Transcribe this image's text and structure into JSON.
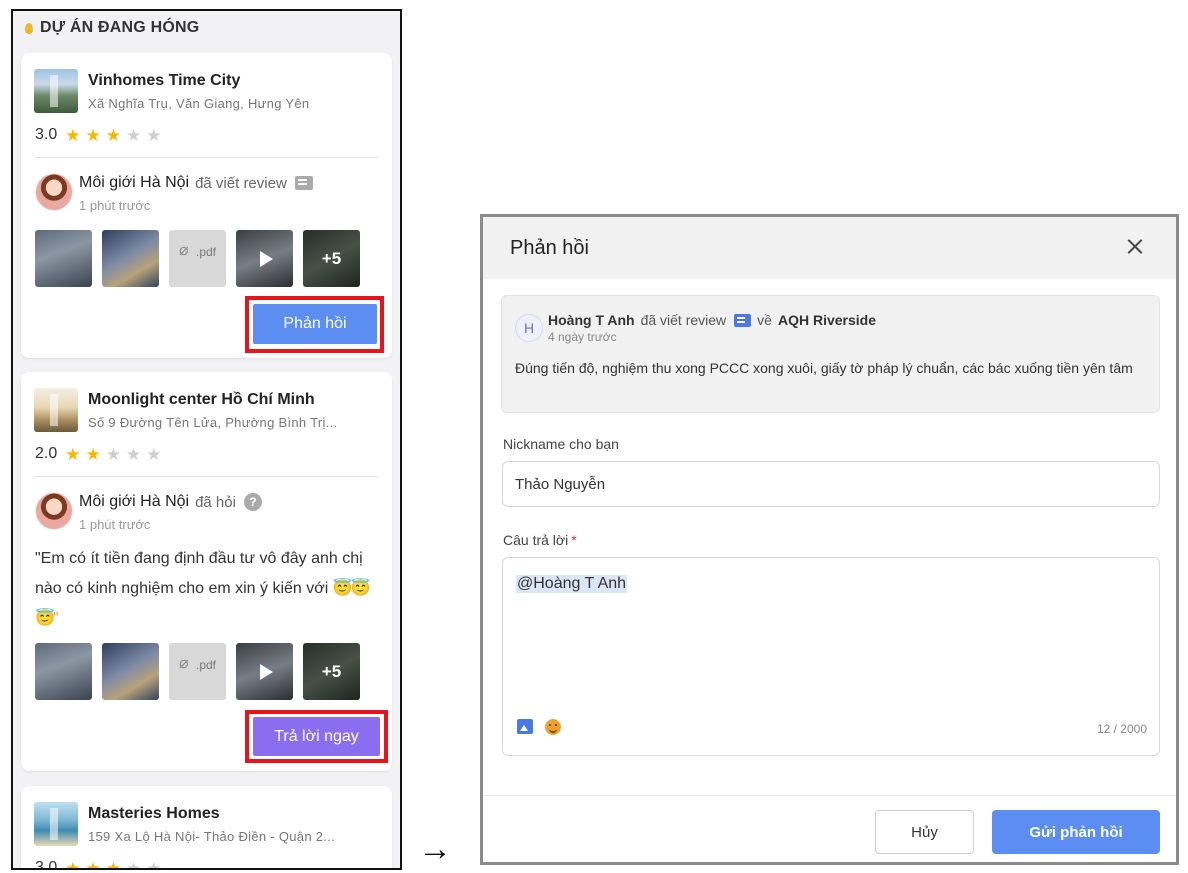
{
  "left": {
    "header": "DỰ ÁN ĐANG HÓNG",
    "cards": [
      {
        "name": "Vinhomes Time City",
        "address": "Xã Nghĩa Trụ, Văn Giang, Hưng Yên",
        "rating": "3.0",
        "stars": 3,
        "reviewer": "Môi giới Hà Nội",
        "action": "đã viết review",
        "time": "1 phút trước",
        "pdf": ".pdf",
        "more": "+5",
        "button": "Phản hồi"
      },
      {
        "name": "Moonlight center Hồ Chí Minh",
        "address": "Số 9 Đường Tên Lửa, Phường Bình Trị...",
        "rating": "2.0",
        "stars": 2,
        "reviewer": "Môi giới Hà Nội",
        "action": "đã hỏi",
        "time": "1 phút trước",
        "question": "\"Em có ít tiền đang định đầu tư vô đây anh chị nào có kinh nghiệm cho em xin ý kiến với",
        "question_emoji": "😇😇😇\"",
        "pdf": ".pdf",
        "more": "+5",
        "button": "Trả lời ngay"
      },
      {
        "name": "Masteries Homes",
        "address": "159 Xa Lộ Hà Nội- Thảo Điền - Quận 2...",
        "rating": "3.0",
        "stars": 3
      }
    ]
  },
  "arrow": "→",
  "modal": {
    "title": "Phản hồi",
    "review": {
      "avatar_letter": "H",
      "author": "Hoàng T Anh",
      "action": "đã viết review",
      "about": "về",
      "project": "AQH Riverside",
      "time": "4 ngày trước",
      "text": "Đúng tiến độ, nghiệm thu xong PCCC xong xuôi, giấy tờ pháp lý chuẩn, các bác xuống tiền yên tâm"
    },
    "nickname_label": "Nickname cho bạn",
    "nickname_value": "Thảo Nguyễn",
    "answer_label": "Câu trả lời",
    "required_mark": "*",
    "answer_value": "@Hoàng T Anh",
    "counter": "12 / 2000",
    "cancel_label": "Hủy",
    "send_label": "Gửi phản hồi"
  },
  "colors": {
    "primary": "#5b8ef0",
    "answer_button": "#8b6ef0",
    "highlight_outline": "#e8141c",
    "star": "#f5b800"
  }
}
